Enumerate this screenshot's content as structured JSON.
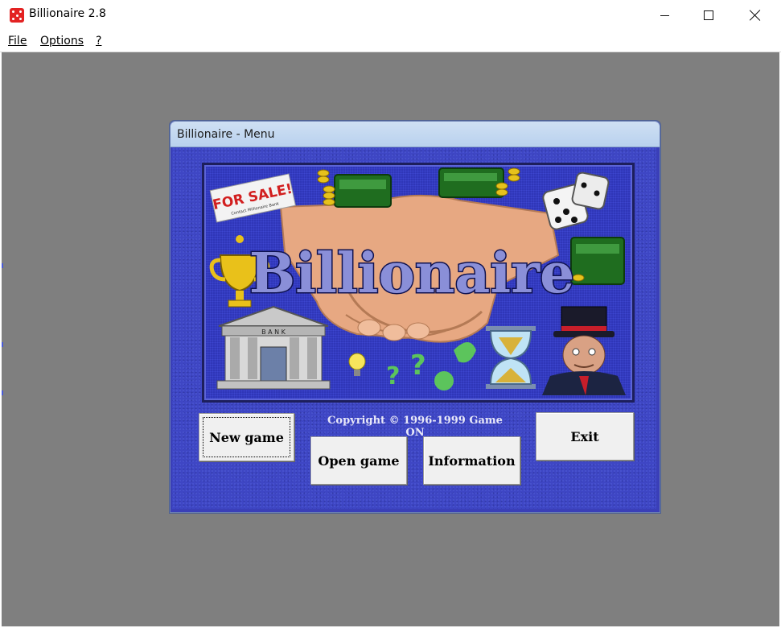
{
  "window": {
    "title": "Billionaire 2.8",
    "controls": {
      "minimize": "minimize",
      "maximize": "maximize",
      "close": "close"
    }
  },
  "menubar": {
    "items": [
      {
        "label": "File",
        "accel": "F"
      },
      {
        "label": "Options",
        "accel": "O"
      },
      {
        "label": "?",
        "accel": "?"
      }
    ]
  },
  "dialog": {
    "title": "Billionaire - Menu",
    "banner": {
      "logo_text": "Billionaire",
      "sign_text": "FOR SALE!",
      "sign_subtext": "Contact Millionaire Bank",
      "bank_label": "B A N K"
    },
    "copyright": "Copyright © 1996-1999 Game ON",
    "buttons": {
      "new_game": "New game",
      "open_game": "Open game",
      "information": "Information",
      "exit": "Exit"
    }
  },
  "colors": {
    "workspace": "#7f7f7f",
    "dialog_bg": "#3e46c4",
    "logo_fill": "#8a8fd8",
    "app_icon": "#e32222"
  }
}
